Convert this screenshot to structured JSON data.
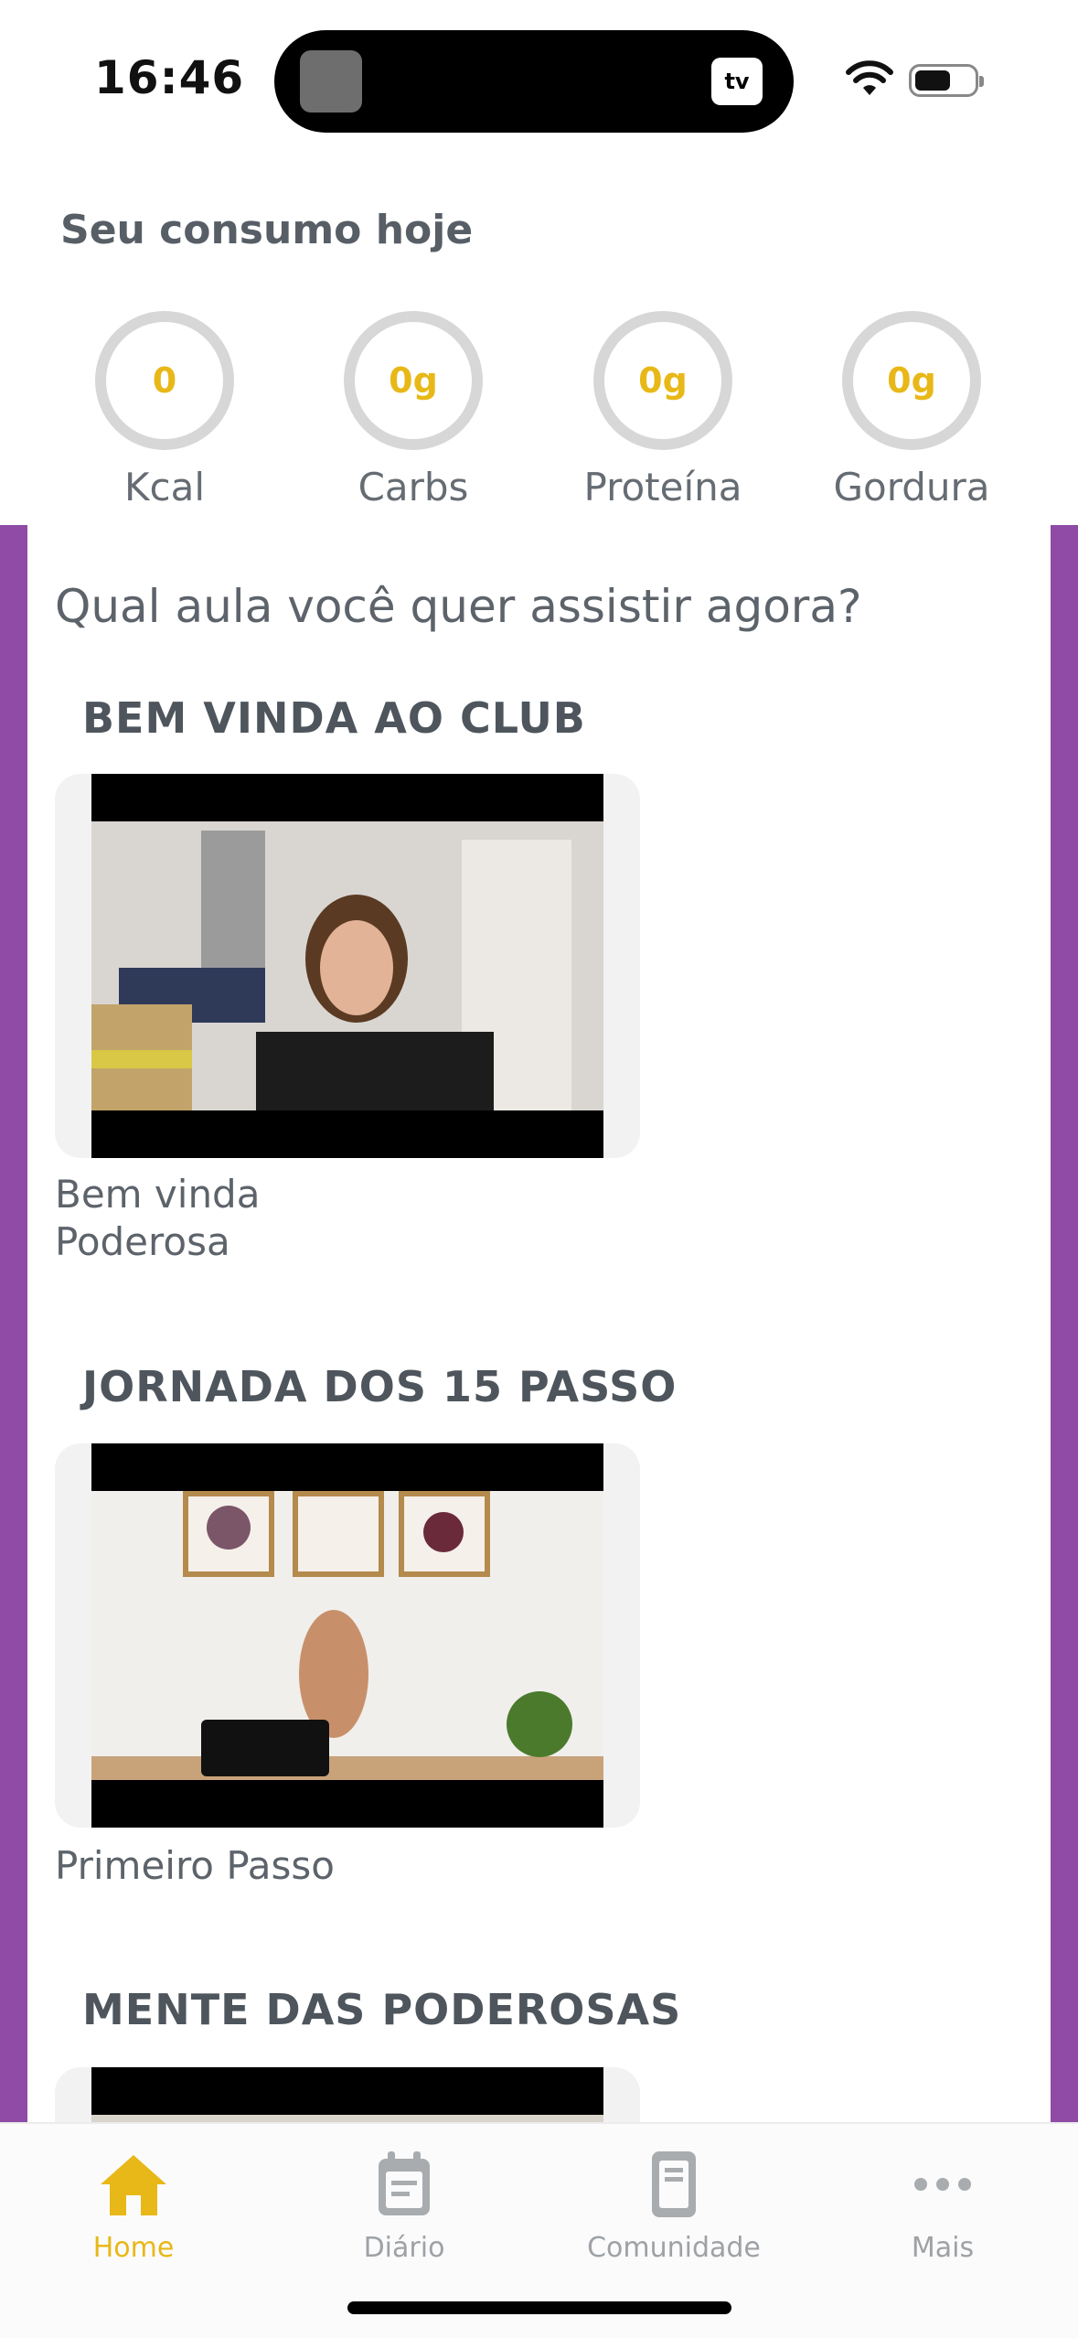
{
  "status": {
    "time": "16:46",
    "island_label": "tv"
  },
  "consumo": {
    "title": "Seu consumo hoje",
    "macros": [
      {
        "value": "0",
        "label": "Kcal"
      },
      {
        "value": "0g",
        "label": "Carbs"
      },
      {
        "value": "0g",
        "label": "Proteína"
      },
      {
        "value": "0g",
        "label": "Gordura"
      }
    ]
  },
  "main": {
    "question": "Qual aula você quer assistir agora?",
    "sections": [
      {
        "title": "BEM VINDA AO CLUB",
        "caption_line1": "Bem vinda",
        "caption_line2": "Poderosa"
      },
      {
        "title": "JORNADA DOS 15 PASSO",
        "caption_line1": "Primeiro Passo"
      },
      {
        "title": "MENTE DAS PODEROSAS"
      }
    ]
  },
  "tabs": [
    {
      "label": "Home",
      "icon": "home-icon"
    },
    {
      "label": "Diário",
      "icon": "diary-icon"
    },
    {
      "label": "Comunidade",
      "icon": "community-icon"
    },
    {
      "label": "Mais",
      "icon": "more-icon"
    }
  ],
  "colors": {
    "accent": "#e8b818",
    "purple": "#8f4ba6",
    "ring": "#d7d7d7",
    "inactive_tab": "#9ea2a6"
  }
}
